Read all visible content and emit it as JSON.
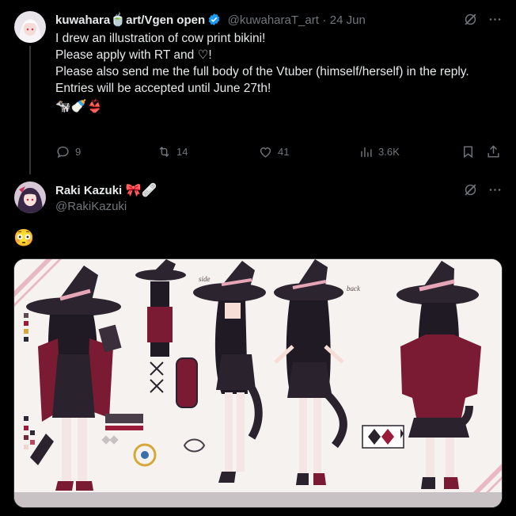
{
  "tweet1": {
    "display_name": "kuwahara",
    "display_name_rest": "art/Vgen open",
    "handle": "@kuwaharaT_art",
    "separator": "·",
    "date": "24 Jun",
    "lines": [
      "I drew an illustration of cow print bikini!",
      "Please apply with RT and ♡!",
      "Please also send me the full body of the Vtuber (himself/herself) in the reply.",
      "Entries will be accepted until June 27th!"
    ],
    "emoji_line": "🐄🍼👙",
    "actions": {
      "replies": "9",
      "reposts": "14",
      "likes": "41",
      "views": "3.6K"
    }
  },
  "tweet2": {
    "display_name": "Raki Kazuki",
    "name_emojis": "🎀🩹",
    "handle": "@RakiKazuki",
    "text": "😳"
  },
  "media": {
    "labels": {
      "side": "side",
      "back": "back"
    }
  },
  "icons": {
    "grok": "grok-icon",
    "more": "more-icon",
    "reply": "reply-icon",
    "repost": "repost-icon",
    "like": "heart-icon",
    "views": "views-icon",
    "bookmark": "bookmark-icon",
    "share": "share-icon"
  },
  "colors": {
    "background": "#000000",
    "text": "#e7e9ea",
    "muted": "#71767b",
    "verified": "#1d9bf0",
    "accent_red": "#9b1c3a"
  }
}
